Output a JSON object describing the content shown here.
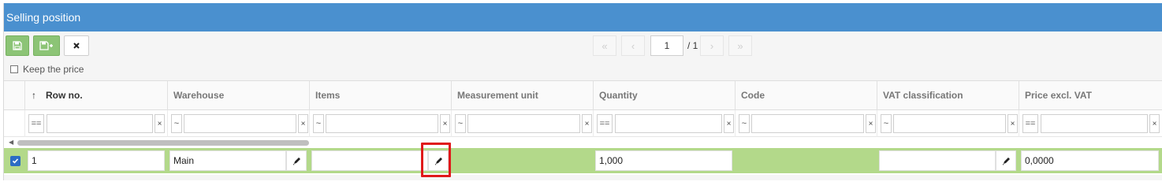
{
  "panel": {
    "title": "Selling position"
  },
  "toolbar": {
    "save_icon": "floppy-disk-icon",
    "save_new_icon": "floppy-disk-plus-icon",
    "close_icon": "close-icon"
  },
  "pager": {
    "first": "«",
    "prev": "‹",
    "page": "1",
    "total": "/ 1",
    "next": "›",
    "last": "»"
  },
  "keep_price": {
    "label": "Keep the price",
    "checked": false
  },
  "columns": [
    {
      "key": "row_no",
      "label": "Row no.",
      "sorted": "asc"
    },
    {
      "key": "warehouse",
      "label": "Warehouse"
    },
    {
      "key": "items",
      "label": "Items"
    },
    {
      "key": "unit",
      "label": "Measurement unit"
    },
    {
      "key": "quantity",
      "label": "Quantity"
    },
    {
      "key": "code",
      "label": "Code"
    },
    {
      "key": "vat",
      "label": "VAT classification"
    },
    {
      "key": "price",
      "label": "Price excl. VAT"
    }
  ],
  "filters": {
    "row_no_op": "==",
    "warehouse_op": "~",
    "items_op": "~",
    "unit_op": "~",
    "quantity_op": "==",
    "code_op": "~",
    "vat_op": "~",
    "price_op": "==",
    "clear": "×"
  },
  "row": {
    "selected": true,
    "row_no": "1",
    "warehouse": "Main",
    "items": "",
    "quantity": "1,000",
    "vat": "",
    "price": "0,0000"
  },
  "colors": {
    "title_bar": "#4a90cf",
    "save_button": "#8cc476",
    "selected_row": "#b3d98a",
    "highlight": "#e0191a"
  }
}
